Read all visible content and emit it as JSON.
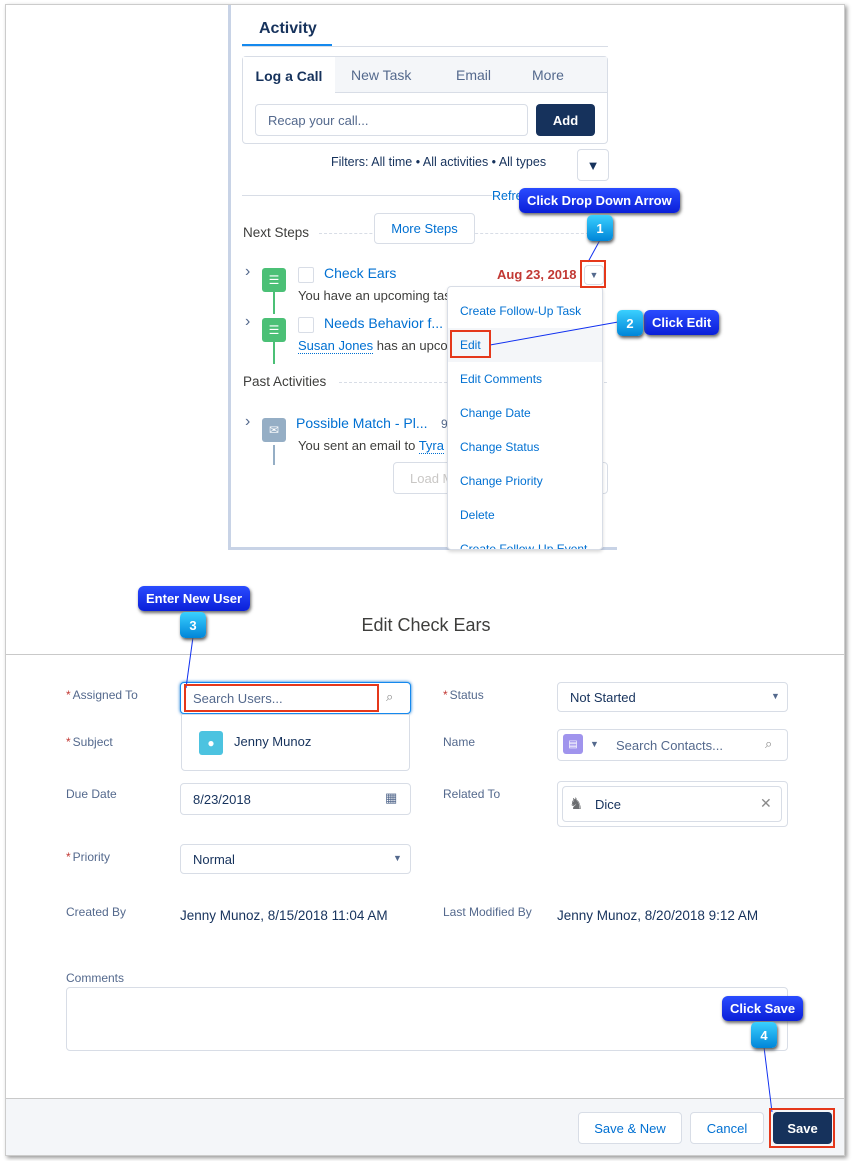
{
  "activity": {
    "title": "Activity",
    "tabs": [
      {
        "label": "Log a Call"
      },
      {
        "label": "New Task"
      },
      {
        "label": "Email"
      },
      {
        "label": "More"
      }
    ],
    "recap_placeholder": "Recap your call...",
    "add_label": "Add",
    "filters": "Filters: All time • All activities • All types",
    "refresh": "Refresh",
    "next_steps": "Next Steps",
    "more_steps": "More Steps",
    "items": [
      {
        "title": "Check Ears",
        "date": "Aug 23, 2018",
        "desc": "You have an upcoming task"
      },
      {
        "title": "Needs Behavior f...",
        "who": "Susan Jones",
        "desc": " has an upcoming"
      }
    ],
    "past_activities": "Past Activities",
    "past": [
      {
        "title": "Possible Match - Pl...",
        "meta": "9",
        "desc": "You sent an email to ",
        "who": "Tyra"
      }
    ],
    "load_more": "Load More"
  },
  "menu": {
    "items": [
      "Create Follow-Up Task",
      "Edit",
      "Edit Comments",
      "Change Date",
      "Change Status",
      "Change Priority",
      "Delete",
      "Create Follow-Up Event"
    ]
  },
  "callouts": [
    {
      "num": "1",
      "text": "Click Drop Down Arrow"
    },
    {
      "num": "2",
      "text": "Click Edit"
    },
    {
      "num": "3",
      "text": "Enter New User"
    },
    {
      "num": "4",
      "text": "Click Save"
    }
  ],
  "modal": {
    "title": "Edit Check Ears",
    "assigned_to": {
      "label": "Assigned To",
      "placeholder": "Search Users..."
    },
    "suggestion": "Jenny Munoz",
    "subject": {
      "label": "Subject"
    },
    "due_date": {
      "label": "Due Date",
      "value": "8/23/2018"
    },
    "priority": {
      "label": "Priority",
      "value": "Normal"
    },
    "created_by": {
      "label": "Created By",
      "value": "Jenny Munoz, 8/15/2018 11:04 AM"
    },
    "status": {
      "label": "Status",
      "value": "Not Started"
    },
    "name": {
      "label": "Name",
      "placeholder": "Search Contacts..."
    },
    "related_to": {
      "label": "Related To",
      "value": "Dice"
    },
    "last_modified_by": {
      "label": "Last Modified By",
      "value": "Jenny Munoz, 8/20/2018 9:12 AM"
    },
    "comments": {
      "label": "Comments",
      "value": ""
    },
    "footer": {
      "save_new": "Save & New",
      "cancel": "Cancel",
      "save": "Save"
    }
  },
  "colors": {
    "brand": "#16325c",
    "link": "#0070d2",
    "task_green": "#4bc076",
    "overdue_red": "#c23934",
    "highlight": "#e5381b",
    "callout_blue": "#1030f0"
  }
}
